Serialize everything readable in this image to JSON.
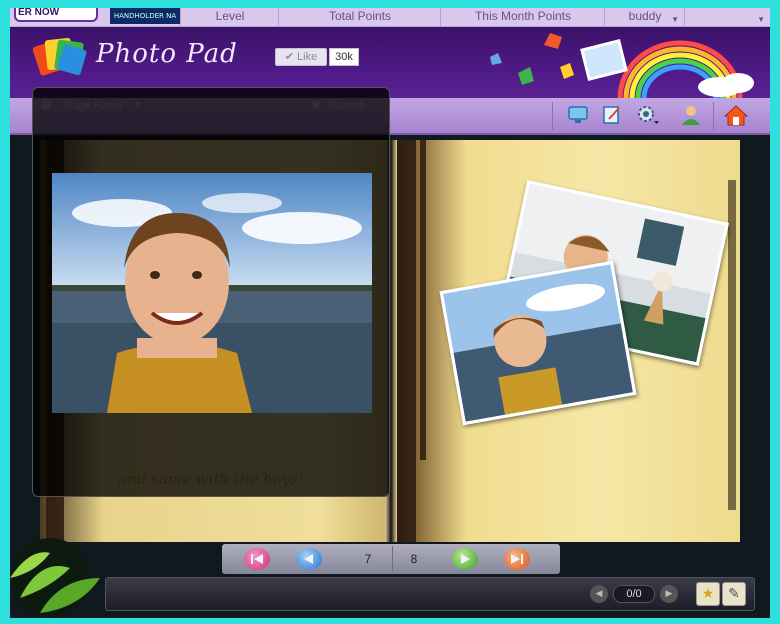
{
  "top_bar": {
    "promo_label": "ER NOW",
    "badge_text": "HANDHOLDER NA",
    "columns": [
      "Level",
      "Total Points",
      "This Month Points",
      "buddy",
      ""
    ]
  },
  "header": {
    "logo_text": "Photo Pad",
    "like_label": "Like",
    "like_count": "30k"
  },
  "panel": {
    "page_panel_label": "Page Panel",
    "publish_label": "Publish",
    "caption": "and same with the boys!"
  },
  "toolbar": {
    "icons": [
      "monitor-icon",
      "book-edit-icon",
      "settings-icon",
      "user-icon",
      "home-icon"
    ]
  },
  "navigation": {
    "left_page": "7",
    "right_page": "8"
  },
  "bottom_bar": {
    "counter": "0/0"
  },
  "colors": {
    "frame_border": "#2ee0dd",
    "header_purple": "#4e1a86",
    "toolbar_lavender": "#b797dd",
    "page_yellow": "#f3e29b"
  }
}
